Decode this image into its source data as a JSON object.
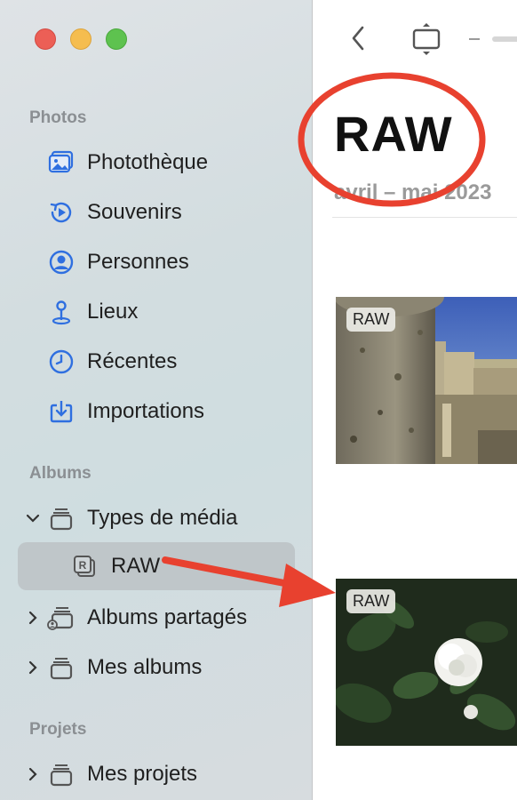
{
  "window": {
    "traffic_lights": [
      "close",
      "minimize",
      "zoom"
    ]
  },
  "sidebar": {
    "sections": {
      "photos": "Photos",
      "albums": "Albums",
      "projects": "Projets"
    },
    "photos_items": [
      {
        "label": "Photothèque",
        "icon": "photo-library-icon"
      },
      {
        "label": "Souvenirs",
        "icon": "memories-icon"
      },
      {
        "label": "Personnes",
        "icon": "person-icon"
      },
      {
        "label": "Lieux",
        "icon": "map-pin-icon"
      },
      {
        "label": "Récentes",
        "icon": "clock-icon"
      },
      {
        "label": "Importations",
        "icon": "import-icon"
      }
    ],
    "albums_items": [
      {
        "label": "Types de média",
        "icon": "album-stack-icon",
        "expanded": true
      },
      {
        "label": "RAW",
        "icon": "raw-icon",
        "selected": true
      },
      {
        "label": "Albums partagés",
        "icon": "shared-album-icon",
        "expanded": false
      },
      {
        "label": "Mes albums",
        "icon": "album-stack-icon",
        "expanded": false
      }
    ],
    "projects_items": [
      {
        "label": "Mes projets",
        "icon": "album-stack-icon",
        "expanded": false
      }
    ]
  },
  "main": {
    "title": "RAW",
    "date_range": "avril – mai 2023",
    "photos": [
      {
        "badge": "RAW",
        "subject": "castle-wall"
      },
      {
        "badge": "RAW",
        "subject": "white-rose"
      }
    ]
  },
  "colors": {
    "accent": "#2f6fe0",
    "annotation": "#e8412f"
  }
}
